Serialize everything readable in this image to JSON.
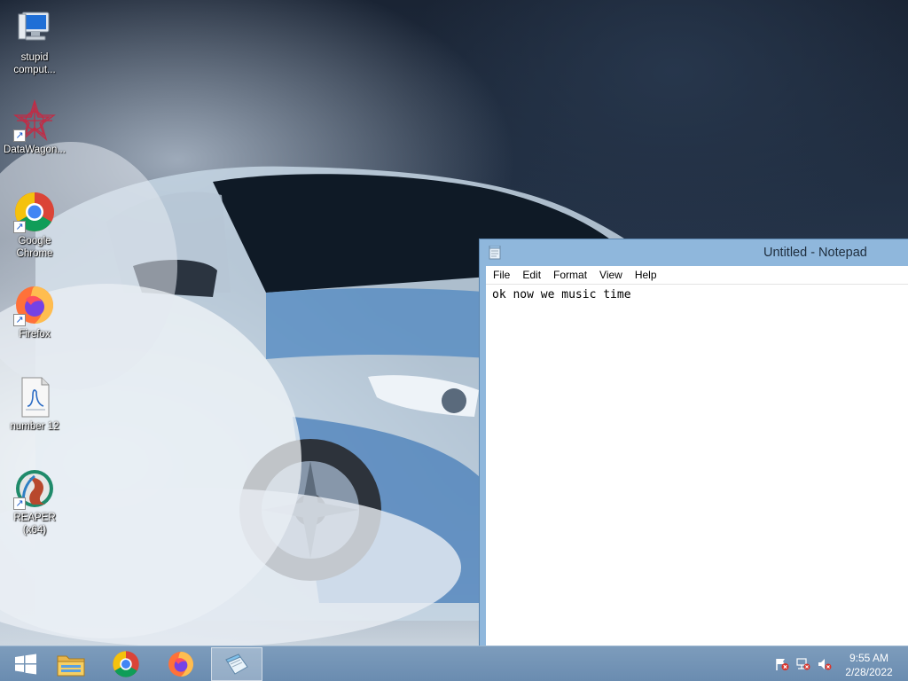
{
  "desktop": {
    "icons": [
      {
        "label": "stupid comput...",
        "icon": "computer-icon"
      },
      {
        "label": "DataWagon...",
        "icon": "datawagon-icon"
      },
      {
        "label": "Google Chrome",
        "icon": "chrome-icon"
      },
      {
        "label": "Firefox",
        "icon": "firefox-icon"
      },
      {
        "label": "number 12",
        "icon": "audio-file-icon"
      },
      {
        "label": "REAPER (x64)",
        "icon": "reaper-icon"
      }
    ]
  },
  "notepad": {
    "title": "Untitled - Notepad",
    "menu": [
      "File",
      "Edit",
      "Format",
      "View",
      "Help"
    ],
    "content": "ok now we music time"
  },
  "taskbar": {
    "start_icon": "windows-start-icon",
    "pinned": [
      "file-explorer-icon",
      "chrome-icon",
      "firefox-icon",
      "notepad-icon"
    ],
    "active_app": "notepad",
    "tray": [
      "action-center-flag-icon",
      "network-icon",
      "volume-muted-icon"
    ],
    "clock": {
      "time": "9:55 AM",
      "date": "2/28/2022"
    }
  },
  "colors": {
    "taskbar": "#6a8cb0",
    "window_frame": "#8fb7dc",
    "accent_red": "#d9342b"
  }
}
